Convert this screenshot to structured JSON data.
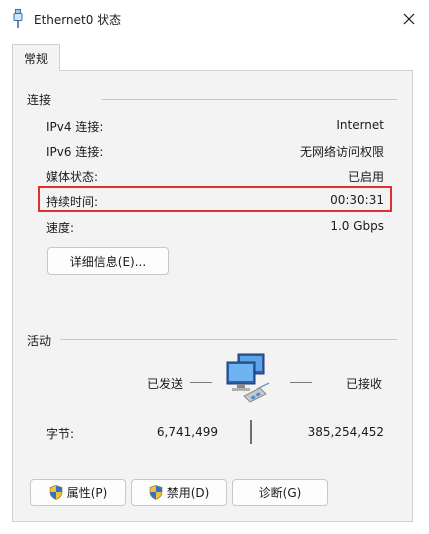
{
  "window": {
    "title": "Ethernet0 状态",
    "icon": "ethernet-plug-icon",
    "close_icon": "close-icon"
  },
  "tabs": [
    {
      "label": "常规",
      "selected": true
    }
  ],
  "connection": {
    "section_label": "连接",
    "rows": [
      {
        "label": "IPv4 连接:",
        "value": "Internet"
      },
      {
        "label": "IPv6 连接:",
        "value": "无网络访问权限"
      },
      {
        "label": "媒体状态:",
        "value": "已启用"
      },
      {
        "label": "持续时间:",
        "value": "00:30:31"
      },
      {
        "label": "速度:",
        "value": "1.0 Gbps"
      }
    ],
    "details_button": "详细信息(E)..."
  },
  "activity": {
    "section_label": "活动",
    "sent_label": "已发送",
    "received_label": "已接收",
    "icon": "network-computers-icon",
    "bytes_label": "字节:",
    "bytes_sent": "6,741,499",
    "bytes_received": "385,254,452"
  },
  "buttons": {
    "properties": "属性(P)",
    "disable": "禁用(D)",
    "diagnose": "诊断(G)"
  },
  "colors": {
    "highlight_border": "#e03030",
    "panel_bg": "#f3f3f3",
    "window_bg": "#ffffff"
  }
}
